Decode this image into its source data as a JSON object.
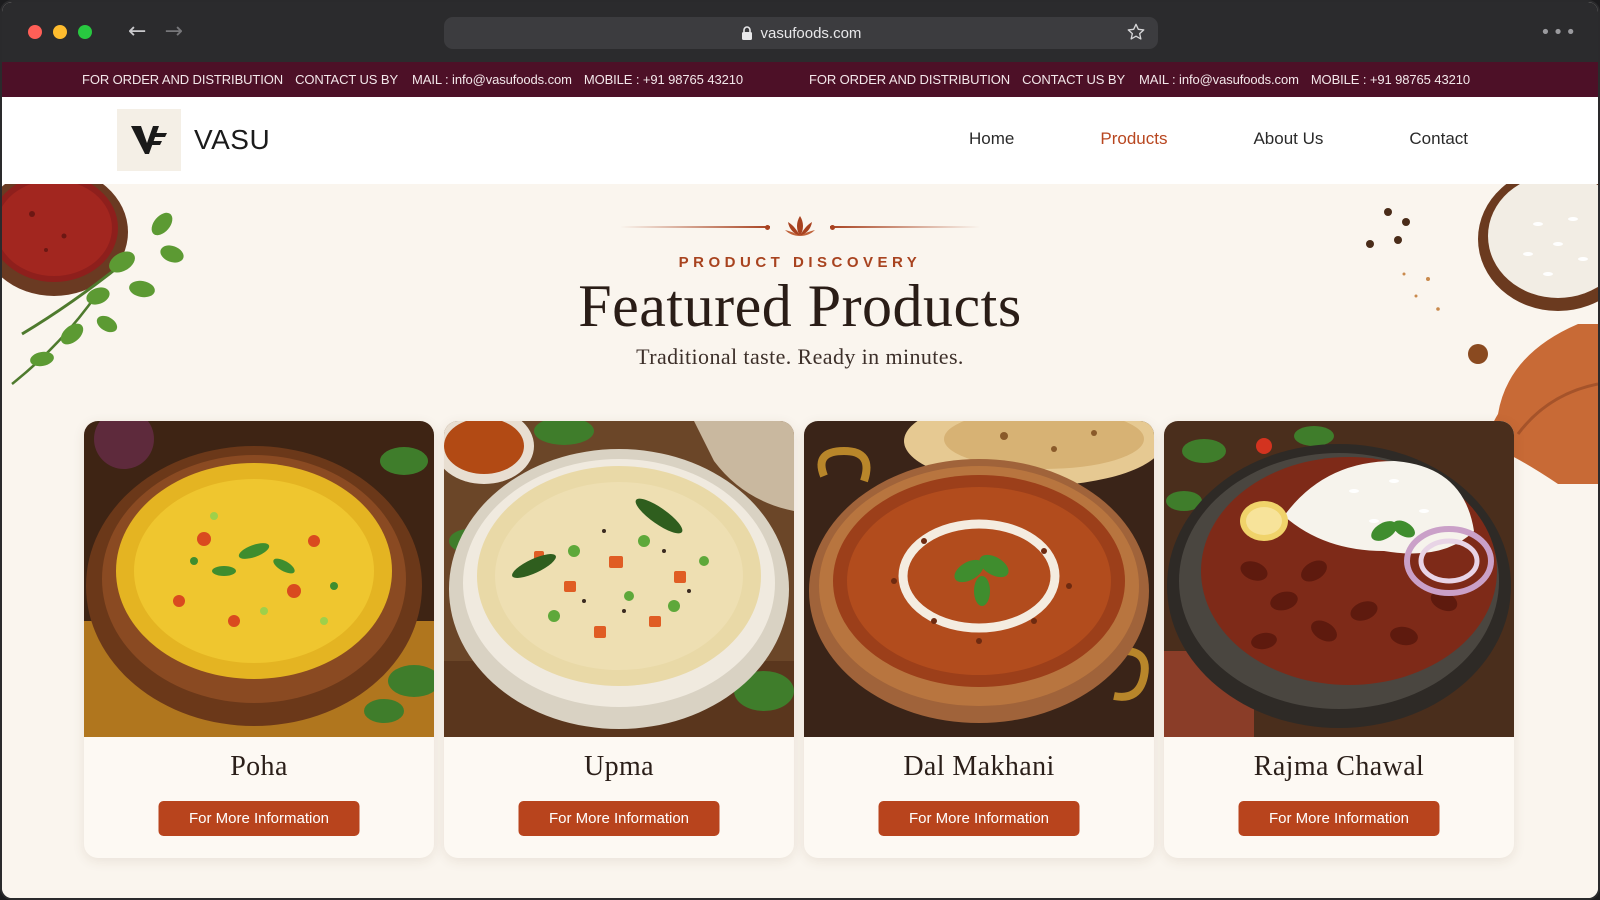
{
  "browser": {
    "url": "vasufoods.com"
  },
  "infobar": {
    "groups": [
      {
        "order_text": "FOR ORDER AND DISTRIBUTION",
        "contact_text": "CONTACT US BY",
        "mail_text": "MAIL : info@vasufoods.com",
        "mobile_text": "MOBILE : +91 98765 43210"
      },
      {
        "order_text": "FOR ORDER AND DISTRIBUTION",
        "contact_text": "CONTACT US BY",
        "mail_text": "MAIL : info@vasufoods.com",
        "mobile_text": "MOBILE : +91 98765 43210"
      }
    ]
  },
  "header": {
    "brand": "VASU",
    "nav": [
      {
        "label": "Home",
        "active": false
      },
      {
        "label": "Products",
        "active": true
      },
      {
        "label": "About Us",
        "active": false
      },
      {
        "label": "Contact",
        "active": false
      }
    ]
  },
  "hero": {
    "eyebrow": "PRODUCT DISCOVERY",
    "title": "Featured Products",
    "tagline": "Traditional taste. Ready in minutes."
  },
  "products": [
    {
      "name": "Poha",
      "button_label": "For More Information"
    },
    {
      "name": "Upma",
      "button_label": "For More Information"
    },
    {
      "name": "Dal Makhani",
      "button_label": "For More Information"
    },
    {
      "name": "Rajma Chawal",
      "button_label": "For More Information"
    }
  ],
  "colors": {
    "infobar_bg": "#4d1027",
    "accent": "#b8441d",
    "active_nav": "#b8461f",
    "page_bg": "#faf5ee"
  },
  "icons": {
    "lock": "lock-icon",
    "star": "star-icon",
    "lotus": "lotus-icon",
    "logo": "vasu-logo-mark"
  }
}
